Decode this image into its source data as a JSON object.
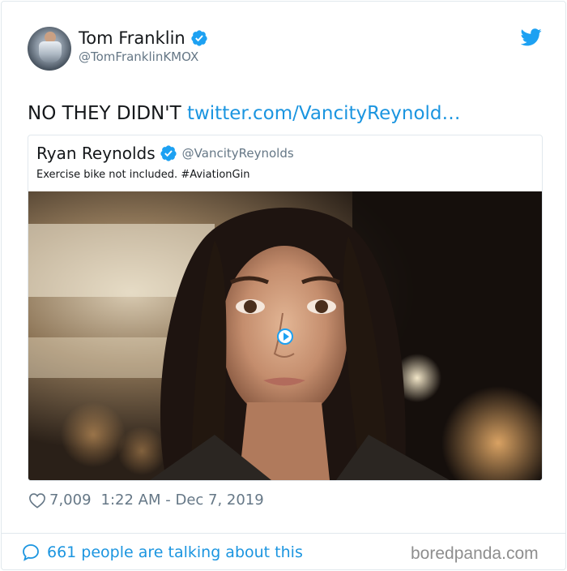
{
  "author": {
    "display_name": "Tom Franklin",
    "handle": "@TomFranklinKMOX",
    "verified": true
  },
  "tweet": {
    "text": "NO THEY DIDN'T",
    "link_text": "twitter.com/VancityReynold…"
  },
  "quoted_tweet": {
    "display_name": "Ryan Reynolds",
    "handle": "@VancityReynolds",
    "verified": true,
    "text": "Exercise bike not included. #AviationGin"
  },
  "meta": {
    "likes": "7,009",
    "timestamp": "1:22 AM - Dec 7, 2019"
  },
  "footer": {
    "talk_label": "661 people are talking about this",
    "watermark": "boredpanda.com"
  },
  "icons": {
    "verified": "verified-badge-icon",
    "twitter": "twitter-bird-icon",
    "like": "heart-icon",
    "replies": "speech-bubble-icon",
    "play": "play-icon"
  },
  "colors": {
    "link": "#1b95e0",
    "verified": "#1da1f2",
    "muted": "#657786"
  }
}
